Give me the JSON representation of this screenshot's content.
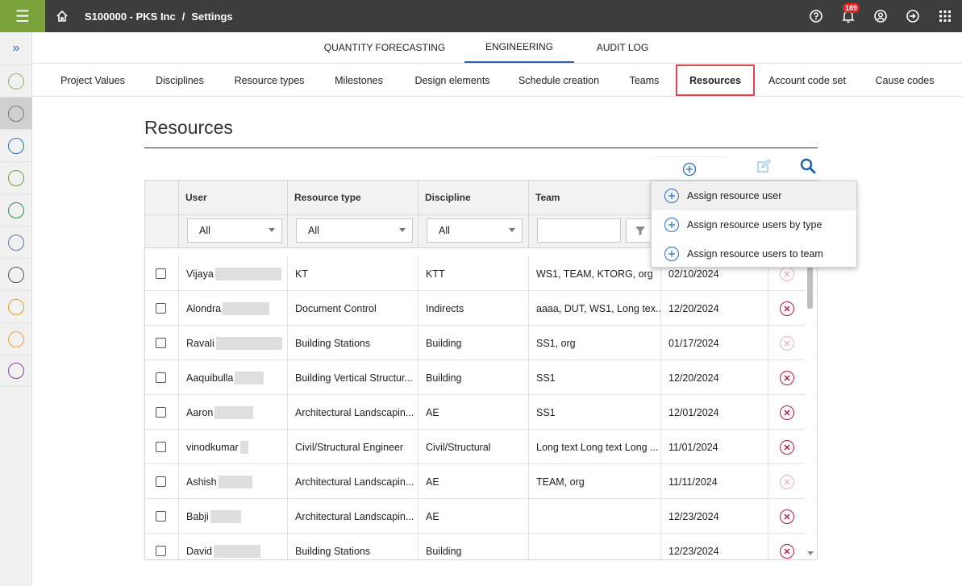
{
  "topbar": {
    "breadcrumb_company": "S100000 - PKS Inc",
    "breadcrumb_separator": "/",
    "breadcrumb_page": "Settings",
    "notification_count": "189",
    "accent_color": "#7aa23a"
  },
  "main_tabs": [
    "QUANTITY FORECASTING",
    "ENGINEERING",
    "AUDIT LOG"
  ],
  "active_main_tab": "ENGINEERING",
  "sub_tabs": [
    "Project Values",
    "Disciplines",
    "Resource types",
    "Milestones",
    "Design elements",
    "Schedule creation",
    "Teams",
    "Resources",
    "Account code set",
    "Cause codes"
  ],
  "active_sub_tab": "Resources",
  "page_title": "Resources",
  "table": {
    "columns": [
      "User",
      "Resource type",
      "Discipline",
      "Team"
    ],
    "filters": {
      "user": "All",
      "resource_type": "All",
      "discipline": "All",
      "team": ""
    },
    "rows": [
      {
        "user": "Vijaya",
        "resource_type": "KT",
        "discipline": "KTT",
        "team": "WS1, TEAM, KTORG, org",
        "date": "02/10/2024",
        "remove_enabled": false
      },
      {
        "user": "Alondra",
        "resource_type": "Document Control",
        "discipline": "Indirects",
        "team": "aaaa, DUT, WS1, Long tex...",
        "date": "12/20/2024",
        "remove_enabled": true
      },
      {
        "user": "Ravali",
        "resource_type": "Building Stations",
        "discipline": "Building",
        "team": "SS1, org",
        "date": "01/17/2024",
        "remove_enabled": false
      },
      {
        "user": "Aaquibulla",
        "resource_type": "Building Vertical Structur...",
        "discipline": "Building",
        "team": "SS1",
        "date": "12/20/2024",
        "remove_enabled": true
      },
      {
        "user": "Aaron",
        "resource_type": "Architectural Landscapin...",
        "discipline": "AE",
        "team": "SS1",
        "date": "12/01/2024",
        "remove_enabled": true
      },
      {
        "user": "vinodkumar",
        "resource_type": "Civil/Structural Engineer",
        "discipline": "Civil/Structural",
        "team": "Long text Long text Long ...",
        "date": "11/01/2024",
        "remove_enabled": true
      },
      {
        "user": "Ashish",
        "resource_type": "Architectural Landscapin...",
        "discipline": "AE",
        "team": "TEAM, org",
        "date": "11/11/2024",
        "remove_enabled": false
      },
      {
        "user": "Babji",
        "resource_type": "Architectural Landscapin...",
        "discipline": "AE",
        "team": "",
        "date": "12/23/2024",
        "remove_enabled": true
      },
      {
        "user": "David",
        "resource_type": "Building Stations",
        "discipline": "Building",
        "team": "",
        "date": "12/23/2024",
        "remove_enabled": true
      }
    ]
  },
  "add_menu": {
    "items": [
      "Assign resource user",
      "Assign resource users by type",
      "Assign resource users to team"
    ]
  }
}
